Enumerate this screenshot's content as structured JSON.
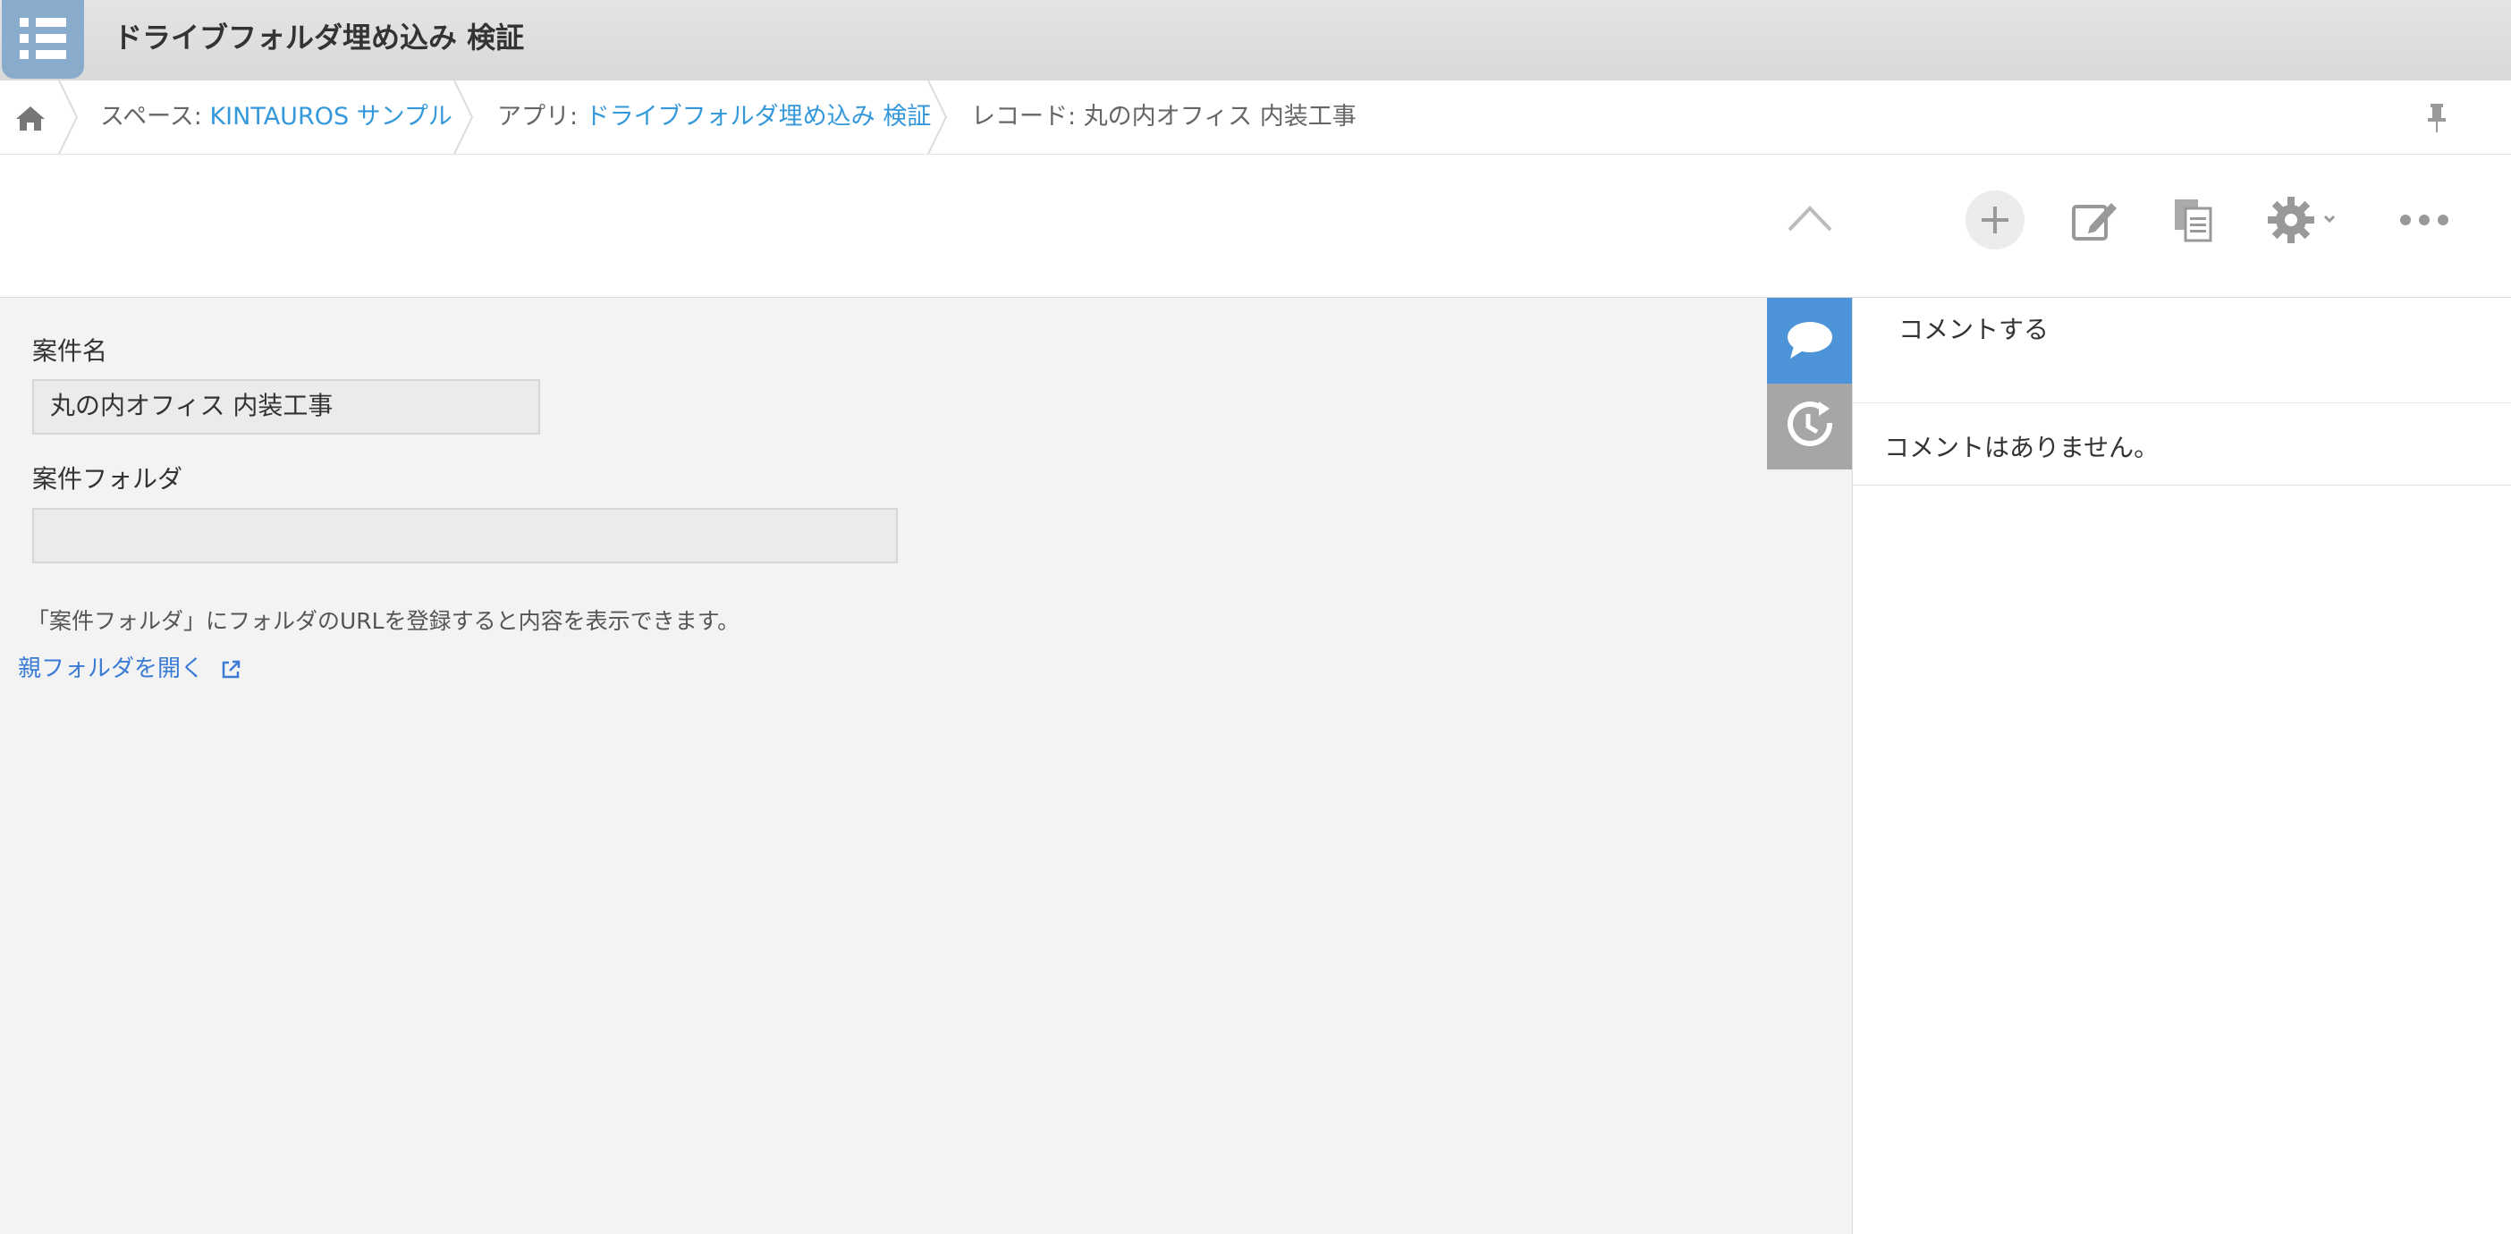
{
  "app": {
    "title": "ドライブフォルダ埋め込み 検証"
  },
  "breadcrumb": {
    "home_icon": "home-icon",
    "space_prefix": "スペース: ",
    "space_name": "KINTAUROS サンプル",
    "app_prefix": "アプリ: ",
    "app_name": "ドライブフォルダ埋め込み 検証",
    "record_prefix": "レコード: ",
    "record_name": "丸の内オフィス 内装工事",
    "pin_icon": "pin-icon"
  },
  "toolbar": {
    "buttons": [
      {
        "icon": "chevron-up-icon"
      },
      {
        "icon": "plus-icon"
      },
      {
        "icon": "edit-icon"
      },
      {
        "icon": "duplicate-icon"
      },
      {
        "icon": "gear-icon"
      },
      {
        "icon": "more-icon"
      }
    ]
  },
  "form": {
    "fields": [
      {
        "label": "案件名",
        "value": "丸の内オフィス 内装工事"
      },
      {
        "label": "案件フォルダ",
        "value": ""
      }
    ],
    "note": "「案件フォルダ」にフォルダのURLを登録すると内容を表示できます。",
    "parent_link": "親フォルダを開く"
  },
  "side_tabs": [
    {
      "icon": "comment-icon",
      "active": true
    },
    {
      "icon": "history-icon",
      "active": false
    }
  ],
  "comments": {
    "input_placeholder": "コメントする",
    "empty_message": "コメントはありません。"
  },
  "colors": {
    "link": "#3498db",
    "active_tab": "#4c93d8",
    "app_icon": "#8aaccc"
  }
}
